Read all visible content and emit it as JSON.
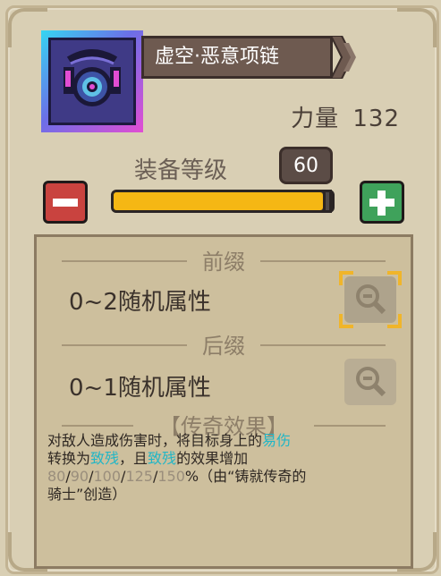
{
  "item": {
    "name": "虚空·恶意项链",
    "power_label": "力量",
    "power_value": "132",
    "icon": "void-necklace-icon"
  },
  "level": {
    "label": "装备等级",
    "value": "60",
    "slider_fraction": 1.0,
    "minus_icon": "minus-icon",
    "plus_icon": "plus-icon"
  },
  "prefix": {
    "title": "前缀",
    "text": "0~2随机属性"
  },
  "suffix": {
    "title": "后缀",
    "text": "0~1随机属性"
  },
  "legendary": {
    "title": "【传奇效果】",
    "line1_a": "对敌人造成伤害时，将目标身上的",
    "line1_b": "易伤",
    "line2_a": "转换为",
    "line2_b": "致残",
    "line2_c": "，且",
    "line2_d": "致残",
    "line2_e": "的效果增加",
    "tier_1": "80",
    "tier_2": "90",
    "tier_3": "100",
    "tier_4": "125",
    "tier_5": "150",
    "line3_suffix": "%（由“铸就传奇的",
    "line4": "骑士”创造）"
  },
  "colors": {
    "highlight": "#22b6c6",
    "slider": "#f5b714",
    "minus": "#c9433f",
    "plus": "#3fa25b"
  }
}
